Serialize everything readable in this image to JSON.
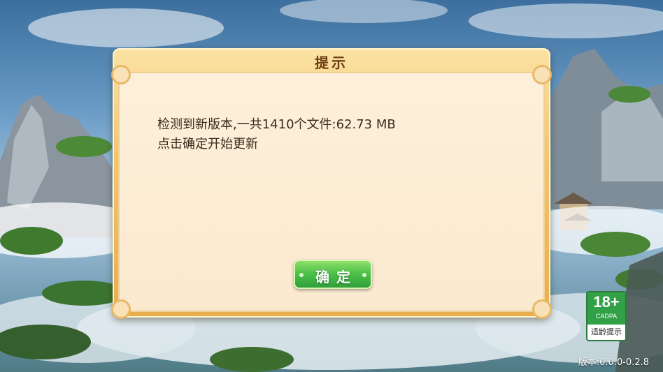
{
  "dialog": {
    "title": "提示",
    "message_line1": "检测到新版本,一共1410个文件:62.73 MB",
    "message_line2": "点击确定开始更新",
    "confirm_label": "确定"
  },
  "age_badge": {
    "rating": "18+",
    "org": "CADPA",
    "tip": "适龄提示"
  },
  "version_text": "版本:0.0.0-0.2.8",
  "colors": {
    "dialog_frame": "#f3c56f",
    "dialog_panel": "#fdf0da",
    "title_text": "#6e3a12",
    "message_text": "#3c2a1c",
    "confirm_button": "#4fc24a",
    "age_badge_green": "#31a046"
  }
}
